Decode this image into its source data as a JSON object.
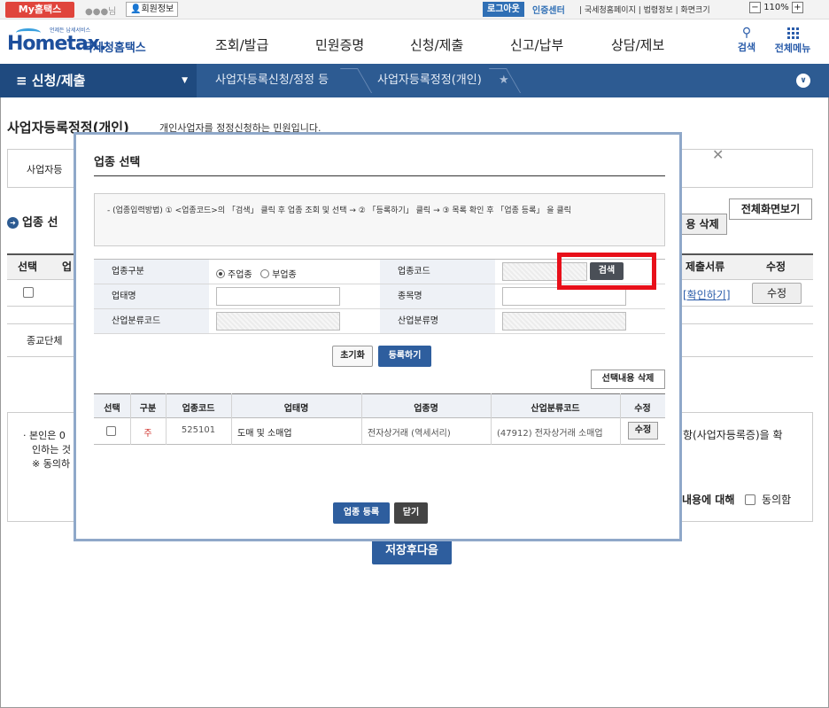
{
  "topbar": {
    "myhome": "My홈택스",
    "user_name": "●●●님",
    "member_info": "회원정보",
    "logout": "로그아웃",
    "cert_center": "인증센터",
    "links": "| 국세청홈페이지 | 법령정보 | 화면크기",
    "zoom": "110%",
    "zoom_minus": "−",
    "zoom_plus": "+"
  },
  "header": {
    "logo_sub": "언제든 납세서비스",
    "logo_mark": "Hometax.",
    "logo_kr": "국세청홈택스",
    "nav": [
      "조회/발급",
      "민원증명",
      "신청/제출",
      "신고/납부",
      "상담/제보"
    ],
    "search": "검색",
    "all_menu": "전체메뉴"
  },
  "breadcrumb": {
    "main": "≡  신청/제출",
    "items": [
      "사업자등록신청/정정 등",
      "사업자등록정정(개인)"
    ]
  },
  "page": {
    "title": "사업자등록정정(개인)",
    "desc": "개인사업자를 정정신청하는 민원입니다.",
    "box1_text": "사업자등",
    "section": "업종 선",
    "full_view": "전체화면보기",
    "del_btn": "용 삭제",
    "col_select": "선택",
    "col_biz": "업",
    "col_docs": "제출서류",
    "col_edit": "수정",
    "confirm_link": "[확인하기]",
    "edit_btn": "수정",
    "box2_text": "종교단체",
    "note_line1": "본인은 0",
    "note_line2": "인하는 것",
    "note_line3": "※  동의하",
    "right_text": "항(사업자등록증)을 확",
    "agree_pre": "내용에 대해",
    "agree": "동의함",
    "save_next": "저장후다음"
  },
  "modal": {
    "title": "업종 선택",
    "info": "- (업종입력방법) ① <업종코드>의 「검색」 클릭 후 업종 조회 및 선택 → ② 「등록하기」 클릭 → ③ 목록 확인 후 「업종 등록」 을 클릭",
    "labels": {
      "type": "업종구분",
      "code": "업종코드",
      "biz_type": "업태명",
      "item": "종목명",
      "ind_code": "산업분류코드",
      "ind_name": "산업분류명"
    },
    "radio_main": "주업종",
    "radio_sub": "부업종",
    "search": "검색",
    "reset": "초기화",
    "register": "등록하기",
    "delete_selected": "선택내용 삭제",
    "table": {
      "headers": [
        "선택",
        "구분",
        "업종코드",
        "업태명",
        "업종명",
        "산업분류코드",
        "수정"
      ],
      "rows": [
        {
          "type": "주",
          "code": "525101",
          "biz": "도매 및 소매업",
          "item": "전자상거래 (역세서리)",
          "ind": "(47912) 전자상거래 소매업",
          "edit": "수정"
        }
      ]
    },
    "biz_register": "업종 등록",
    "close": "닫기"
  },
  "colors": {
    "accent_blue": "#2e5e9e",
    "highlight_red": "#e8101a",
    "myhome_red": "#e0453c"
  }
}
